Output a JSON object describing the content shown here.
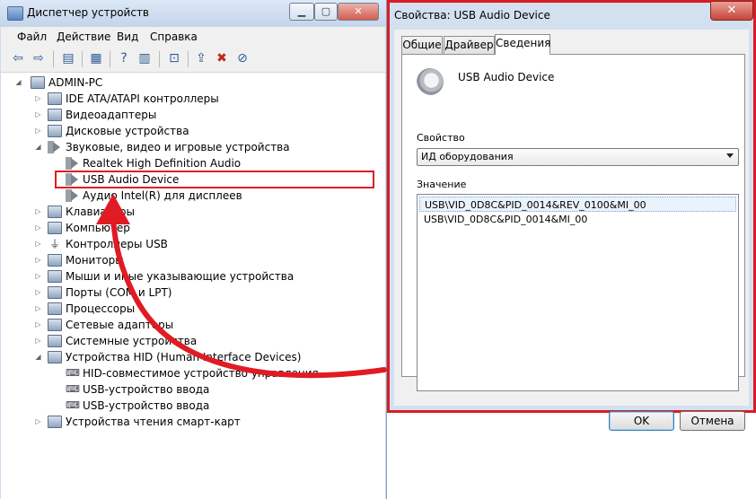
{
  "device_manager": {
    "title": "Диспетчер устройств",
    "menu": [
      "Файл",
      "Действие",
      "Вид",
      "Справка"
    ],
    "toolbar_icons": [
      "back-icon",
      "forward-icon",
      "console-tree-icon",
      "properties-page-icon",
      "help-icon",
      "toggle-view-icon",
      "scan-hardware-icon",
      "update-driver-icon",
      "uninstall-icon",
      "disable-device-icon"
    ],
    "tree": {
      "root": "ADMIN-PC",
      "items": [
        {
          "label": "IDE ATA/ATAPI контроллеры",
          "level": 1,
          "expander": "▷",
          "icon": "ide-icon"
        },
        {
          "label": "Видеоадаптеры",
          "level": 1,
          "expander": "▷",
          "icon": "display-adapter-icon"
        },
        {
          "label": "Дисковые устройства",
          "level": 1,
          "expander": "▷",
          "icon": "disk-icon"
        },
        {
          "label": "Звуковые, видео и игровые устройства",
          "level": 1,
          "expander": "◢",
          "icon": "sound-icon"
        },
        {
          "label": "Realtek High Definition Audio",
          "level": 2,
          "expander": "",
          "icon": "speaker-icon"
        },
        {
          "label": "USB Audio Device",
          "level": 2,
          "expander": "",
          "icon": "speaker-icon"
        },
        {
          "label": "Аудио Intel(R) для дисплеев",
          "level": 2,
          "expander": "",
          "icon": "speaker-icon"
        },
        {
          "label": "Клавиатуры",
          "level": 1,
          "expander": "▷",
          "icon": "keyboard-icon"
        },
        {
          "label": "Компьютер",
          "level": 1,
          "expander": "▷",
          "icon": "computer-icon"
        },
        {
          "label": "Контроллеры USB",
          "level": 1,
          "expander": "▷",
          "icon": "usb-icon"
        },
        {
          "label": "Мониторы",
          "level": 1,
          "expander": "▷",
          "icon": "monitor-icon"
        },
        {
          "label": "Мыши и иные указывающие устройства",
          "level": 1,
          "expander": "▷",
          "icon": "mouse-icon"
        },
        {
          "label": "Порты (COM и LPT)",
          "level": 1,
          "expander": "▷",
          "icon": "port-icon"
        },
        {
          "label": "Процессоры",
          "level": 1,
          "expander": "▷",
          "icon": "cpu-icon"
        },
        {
          "label": "Сетевые адаптеры",
          "level": 1,
          "expander": "▷",
          "icon": "network-icon"
        },
        {
          "label": "Системные устройства",
          "level": 1,
          "expander": "▷",
          "icon": "system-icon"
        },
        {
          "label": "Устройства HID (Human Interface Devices)",
          "level": 1,
          "expander": "◢",
          "icon": "hid-icon"
        },
        {
          "label": "HID-совместимое устройство управления",
          "level": 2,
          "expander": "",
          "icon": "hid-device-icon"
        },
        {
          "label": "USB-устройство ввода",
          "level": 2,
          "expander": "",
          "icon": "hid-device-icon"
        },
        {
          "label": "USB-устройство ввода",
          "level": 2,
          "expander": "",
          "icon": "hid-device-icon"
        },
        {
          "label": "Устройства чтения смарт-карт",
          "level": 1,
          "expander": "▷",
          "icon": "smartcard-icon"
        }
      ]
    }
  },
  "properties_dialog": {
    "title": "Свойства: USB Audio Device",
    "close_glyph": "✕",
    "tabs": [
      "Общие",
      "Драйвер",
      "Сведения"
    ],
    "active_tab": "Сведения",
    "device_name": "USB Audio Device",
    "property_label": "Свойство",
    "property_selected": "ИД оборудования",
    "value_label": "Значение",
    "values": [
      "USB\\VID_0D8C&PID_0014&REV_0100&MI_00",
      "USB\\VID_0D8C&PID_0014&MI_00"
    ],
    "ok_label": "OK",
    "cancel_label": "Отмена"
  },
  "annotation": {
    "color": "#e01b24"
  }
}
